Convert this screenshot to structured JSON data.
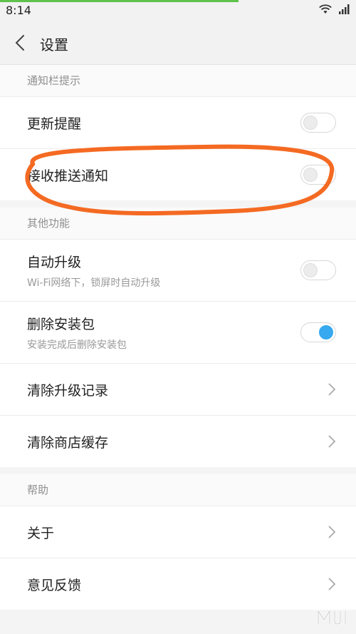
{
  "status": {
    "time": "8:14",
    "progress": 0.67
  },
  "header": {
    "title": "设置"
  },
  "sections": [
    {
      "title": "通知栏提示",
      "items": [
        {
          "label": "更新提醒",
          "control": "toggle",
          "on": false
        },
        {
          "label": "接收推送通知",
          "control": "toggle",
          "on": false
        }
      ]
    },
    {
      "title": "其他功能",
      "items": [
        {
          "label": "自动升级",
          "sub": "Wi-Fi网络下，锁屏时自动升级",
          "control": "toggle",
          "on": false
        },
        {
          "label": "删除安装包",
          "sub": "安装完成后删除安装包",
          "control": "toggle",
          "on": true
        },
        {
          "label": "清除升级记录",
          "control": "chevron"
        },
        {
          "label": "清除商店缓存",
          "control": "chevron"
        }
      ]
    },
    {
      "title": "帮助",
      "items": [
        {
          "label": "关于",
          "control": "chevron"
        },
        {
          "label": "意见反馈",
          "control": "chevron"
        }
      ]
    }
  ],
  "colors": {
    "accent": "#36a9f0",
    "annotation": "#f46a22",
    "progress": "#5fc24a"
  },
  "icons": {
    "back": "chevron-left-icon",
    "wifi": "wifi-icon",
    "signal": "signal-icon",
    "row_arrow": "chevron-right-icon"
  }
}
